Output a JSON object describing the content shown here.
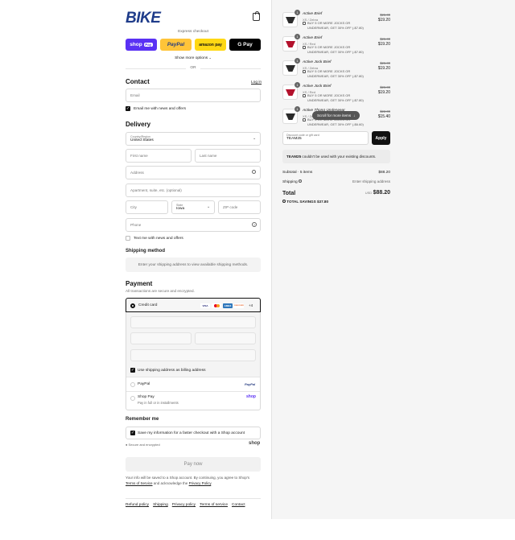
{
  "header": {
    "logo": "BIKE"
  },
  "express": {
    "title": "Express checkout",
    "buttons": {
      "shop": "shop",
      "shop_pay": "Pay",
      "paypal": "PayPal",
      "amazon": "amazon pay",
      "gpay": "G Pay"
    },
    "more": "Show more options",
    "or": "OR"
  },
  "contact": {
    "title": "Contact",
    "login": "Log in",
    "email_placeholder": "Email",
    "news": "Email me with news and offers"
  },
  "delivery": {
    "title": "Delivery",
    "country_label": "Country/Region",
    "country_value": "United States",
    "first": "First name",
    "last": "Last name",
    "address": "Address",
    "apt": "Apartment, suite, etc. (optional)",
    "city": "City",
    "state_label": "State",
    "state_value": "Iowa",
    "zip": "ZIP code",
    "phone": "Phone",
    "text_news": "Text me with news and offers"
  },
  "shipping_method": {
    "title": "Shipping method",
    "note": "Enter your shipping address to view available shipping methods."
  },
  "payment": {
    "title": "Payment",
    "subtitle": "All transactions are secure and encrypted.",
    "credit_card": "Credit card",
    "cards": [
      "VISA",
      "MC",
      "AMEX",
      "DISCOVER"
    ],
    "more_cards": "+4",
    "billing": "Use shipping address as billing address",
    "paypal": "PayPal",
    "paypal_logo": "PayPal",
    "shop_pay": "Shop Pay",
    "shop_pay_sub": "Pay in full or in installments",
    "shop_logo": "shop"
  },
  "remember": {
    "title": "Remember me",
    "save": "Save my information for a faster checkout with a Shop account",
    "secure": "Secure and encrypted",
    "shop_logo": "shop"
  },
  "pay_now": "Pay now",
  "legal": {
    "text_a": "Your info will be saved to a Shop account. By continuing, you agree to Shop's",
    "tos": "Terms of Service",
    "and": "and acknowledge the",
    "privacy": "Privacy Policy",
    "end": "."
  },
  "footer": [
    "Refund policy",
    "Shipping",
    "Privacy policy",
    "Terms of service",
    "Contact"
  ],
  "items": [
    {
      "qty": "1",
      "name": "Active Brief",
      "variant": "XS / Zebra",
      "discount": "BUY 5 OR MORE JOCKS OR UNDERWEAR, GET 30% OFF (-$7.80)",
      "was": "$26.00",
      "price": "$19.20",
      "color": "#2b2b2b"
    },
    {
      "qty": "1",
      "name": "Active Brief",
      "variant": "XS / Red",
      "discount": "BUY 5 OR MORE JOCKS OR UNDERWEAR, GET 30% OFF (-$7.80)",
      "was": "$26.00",
      "price": "$19.20",
      "color": "#b3112c"
    },
    {
      "qty": "1",
      "name": "Active Jock Brief",
      "variant": "XS / Zebra",
      "discount": "BUY 5 OR MORE JOCKS OR UNDERWEAR, GET 30% OFF (-$7.80)",
      "was": "$26.00",
      "price": "$19.20",
      "color": "#2b2b2b"
    },
    {
      "qty": "1",
      "name": "Active Jock Brief",
      "variant": "XS / Red",
      "discount": "BUY 5 OR MORE JOCKS OR UNDERWEAR, GET 30% OFF (-$7.80)",
      "was": "$26.00",
      "price": "$19.20",
      "color": "#b3112c"
    },
    {
      "qty": "1",
      "name": "Active Thong Underwear",
      "variant": "XS / Zebra",
      "discount": "BUY 5 OR MORE JOCKS OR UNDERWEAR, GET 30% OFF (-$6.60)",
      "was": "$22.00",
      "price": "$15.40",
      "color": "#2b2b2b"
    }
  ],
  "scroll_hint": "Scroll for more items",
  "discount": {
    "label": "Discount code or gift card",
    "value": "TEAM25",
    "apply": "Apply",
    "notice_code": "TEAM25",
    "notice_rest": "couldn't be used with your existing discounts."
  },
  "summary": {
    "subtotal_label": "Subtotal · 5 items",
    "subtotal": "$88.20",
    "shipping_label": "Shipping",
    "shipping": "Enter shipping address",
    "total_label": "Total",
    "currency": "USD",
    "total": "$88.20",
    "savings_label": "TOTAL SAVINGS",
    "savings": "$37.80"
  }
}
